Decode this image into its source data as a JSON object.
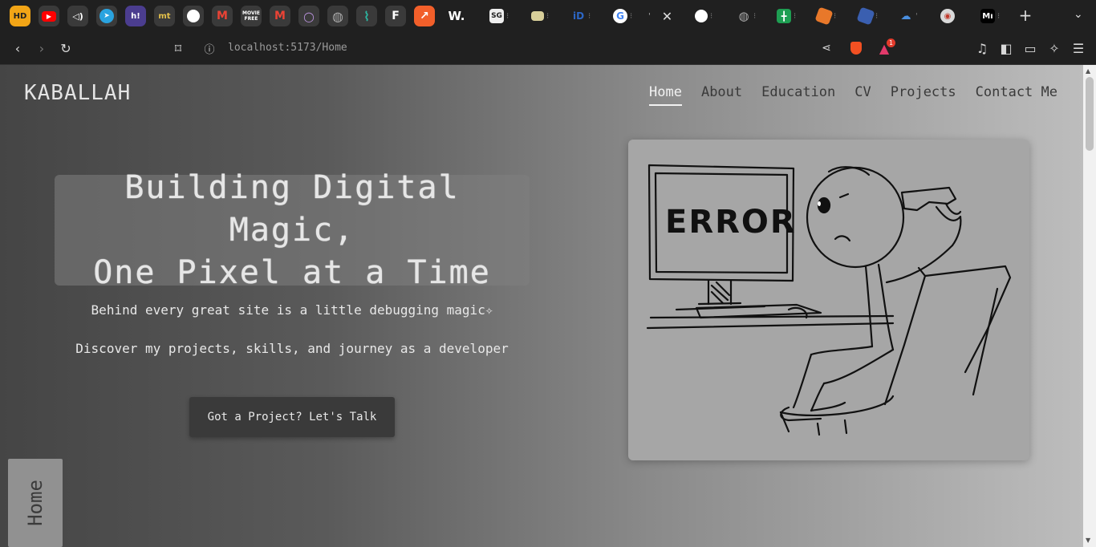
{
  "browser": {
    "tabs": [
      {
        "icon": "hd-icon",
        "label": "HD",
        "color": "#f2a516"
      },
      {
        "icon": "youtube-icon",
        "label": "▶",
        "color": "#ff0000"
      },
      {
        "icon": "speaker-icon",
        "label": "🔊",
        "color": "#3a3a3a"
      },
      {
        "icon": "telegram-icon",
        "label": "➤",
        "color": "#2aa3df"
      },
      {
        "icon": "hashnode-icon",
        "label": "h!",
        "color": "#4b3d8f"
      },
      {
        "icon": "mt-icon",
        "label": "mt",
        "color": "#2b2b2b"
      },
      {
        "icon": "github-icon",
        "label": "●",
        "color": "#2b2b2b"
      },
      {
        "icon": "gmail-icon",
        "label": "M",
        "color": "#2b2b2b"
      },
      {
        "icon": "movie-icon",
        "label": "M",
        "color": "#2b2b2b"
      },
      {
        "icon": "gmail-icon",
        "label": "M",
        "color": "#2b2b2b"
      },
      {
        "icon": "circle-icon",
        "label": "○",
        "color": "#2b2b2b"
      },
      {
        "icon": "globe-icon",
        "label": "◍",
        "color": "#2b2b2b"
      },
      {
        "icon": "pulse-icon",
        "label": "⌇",
        "color": "#2b2b2b"
      },
      {
        "icon": "framer-icon",
        "label": "F",
        "color": "#2b2b2b"
      },
      {
        "icon": "chart-icon",
        "label": "↗",
        "color": "#f25f2a"
      }
    ],
    "tab_dot": "⁝",
    "url_scheme": "localhost",
    "url_rest": ":5173/Home",
    "add_tab": "+",
    "notification_count": "1"
  },
  "site": {
    "logo": "KABALLAH",
    "nav": [
      "Home",
      "About",
      "Education",
      "CV",
      "Projects",
      "Contact Me"
    ],
    "active_nav": "Home",
    "hero_title": "Building Digital Magic,\nOne Pixel at a Time",
    "subtitle_1": "Behind every great site is a little debugging magic✧",
    "subtitle_2": "Discover my projects, skills, and journey as a developer",
    "cta": "Got a Project? Let's Talk",
    "illustration_text": "ERROR",
    "side_label": "Home"
  },
  "colors": {
    "background": "#202020",
    "nav_active": "#f2f2f2",
    "nav_inactive": "#3a3a3a",
    "cta_bg": "#3a3a3a"
  }
}
